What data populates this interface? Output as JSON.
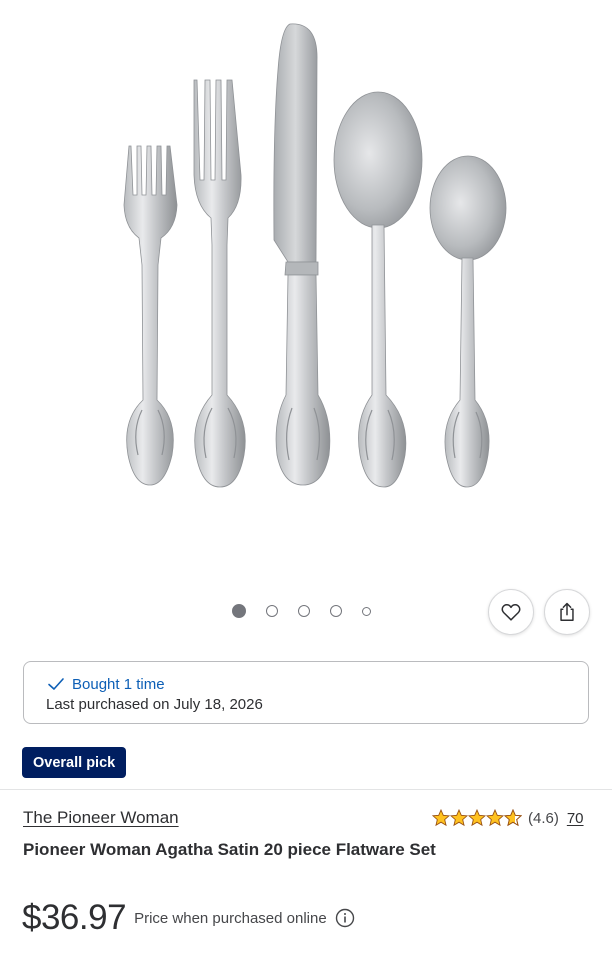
{
  "gallery": {
    "image_alt": "Pioneer Woman Agatha Satin 20 piece Flatware Set product image",
    "total_images": 5,
    "active_index": 0
  },
  "actions": {
    "favorite_icon": "heart-icon",
    "share_icon": "share-icon"
  },
  "purchase_history": {
    "bought_label": "Bought 1 time",
    "last_purchased": "Last purchased on July 18, 2026",
    "check_icon": "checkmark-icon"
  },
  "badge": {
    "label": "Overall pick",
    "color": "#001e60"
  },
  "product": {
    "brand": "The Pioneer Woman",
    "title": "Pioneer Woman Agatha Satin 20 piece Flatware Set",
    "rating": 4.6,
    "rating_display": "(4.6)",
    "review_count": "70",
    "star_color": "#ffc220",
    "price": "$36.97",
    "price_note": "Price when purchased online",
    "info_icon": "info-icon"
  },
  "colors": {
    "link_blue": "#0d5fb6",
    "text": "#2e2f32"
  }
}
